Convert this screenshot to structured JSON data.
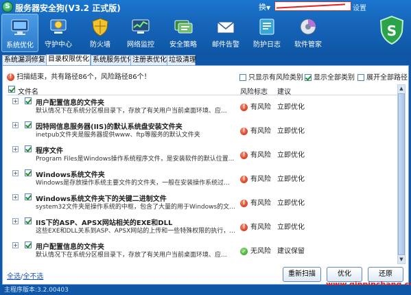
{
  "window": {
    "title": "服务器安全狗(V3.2 正式版)",
    "menu": "换",
    "settings": "设置"
  },
  "toolbar": {
    "items": [
      {
        "label": "系统优化",
        "icon": "monitor-icon"
      },
      {
        "label": "守护中心",
        "icon": "guard-center-icon"
      },
      {
        "label": "防火墙",
        "icon": "firewall-shield-icon"
      },
      {
        "label": "网络监控",
        "icon": "network-monitor-icon"
      },
      {
        "label": "安全策略",
        "icon": "security-policy-icon"
      },
      {
        "label": "邮件告警",
        "icon": "mail-alert-icon"
      },
      {
        "label": "防护日志",
        "icon": "protection-log-icon"
      },
      {
        "label": "软件管家",
        "icon": "software-manager-icon"
      }
    ]
  },
  "tabs": [
    {
      "label": "系统漏洞修复"
    },
    {
      "label": "目录权限优化"
    },
    {
      "label": "系统服务优化"
    },
    {
      "label": "注册表优化"
    },
    {
      "label": "垃圾清理"
    }
  ],
  "scan": {
    "summary": "扫描结束，共有路径86个，风险路径86个！"
  },
  "filters": {
    "only_risk": "只显示有风险类别",
    "show_all": "显示全部类别",
    "expand_all": "展开全部路径"
  },
  "columns": {
    "name": "文件名",
    "risk": "风险标志",
    "advice": "建议"
  },
  "rows": [
    {
      "title": "用户配置信息的文件夹",
      "desc": "默认情况下在系统分区根目录下，存放了有关用户当前桌面环境、应...",
      "risk": "有风险",
      "advice": "立即优化",
      "risk_level": "warn"
    },
    {
      "title": "因特网信息服务器(IIS)的默认系统盘安装文件夹",
      "desc": "inetpub文件夹是服务器提供www、ftp等服务的默认文件夹",
      "risk": "有风险",
      "advice": "立即优化",
      "risk_level": "warn"
    },
    {
      "title": "程序文件",
      "desc": "Program Files是Windows操作系统程序文件，是安装软件的默认位置...",
      "risk": "有风险",
      "advice": "立即优化",
      "risk_level": "warn"
    },
    {
      "title": "Windows系统文件夹",
      "desc": "Windows是存放操作系统主要文件的文件夹，一般在安装操作系统过...",
      "risk": "有风险",
      "advice": "立即优化",
      "risk_level": "warn"
    },
    {
      "title": "Windows系统文件夹下的关键二进制文件",
      "desc": "system32文件夹是操作系统的中枢，包含了大量的用于Windows的文...",
      "risk": "有风险",
      "advice": "立即优化",
      "risk_level": "warn"
    },
    {
      "title": "IIS下的ASP、APSX网站相关的EXE和DLL",
      "desc": "这些EXE和DLL关系到ASP、APSX网站的上传和一些特殊权限的执行，...",
      "risk": "有风险",
      "advice": "立即优化",
      "risk_level": "warn"
    },
    {
      "title": "用户配置信息的文件夹",
      "desc": "默认情况下在系统分区根目录下，存放了有关用户当前桌面环境、应...",
      "risk": "无风险",
      "advice": "建议保留",
      "risk_level": "ok"
    }
  ],
  "footer": {
    "select_all": "全选",
    "separator": "/",
    "select_none": "全不选",
    "rescan": "重新扫描",
    "optimize": "优化",
    "restore": "还原"
  },
  "watermark": "www.qinpinchang.com",
  "status": {
    "version": "主程序版本:3.2.00403"
  },
  "colors": {
    "brand_blue": "#1666bb",
    "risk_red": "#c8200b",
    "safe_green": "#2a9a1b"
  }
}
